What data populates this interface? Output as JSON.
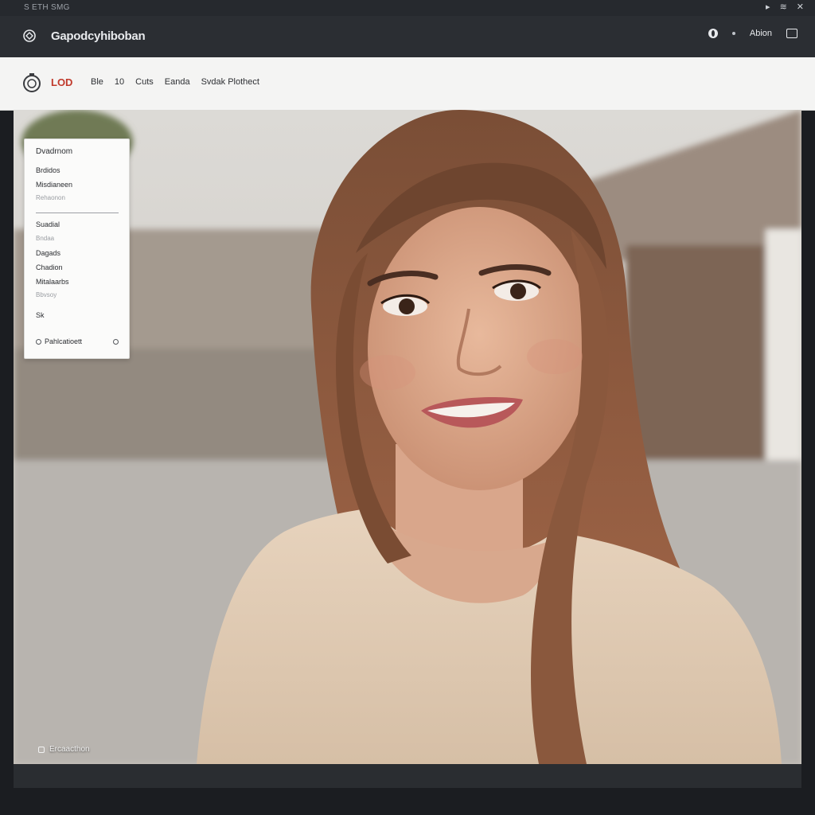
{
  "os_bar": {
    "title": "S ETH SMG",
    "icons": [
      "system-icon",
      "wifi-icon",
      "close-icon"
    ]
  },
  "app_bar": {
    "title": "Gapodcyhiboban",
    "right_label": "Abion",
    "icons": [
      "globe-icon",
      "dot-icon",
      "window-icon"
    ]
  },
  "nav_bar": {
    "brand": "LOD",
    "links": [
      "Ble",
      "10",
      "Cuts",
      "Eanda",
      "Svdak Plothect"
    ]
  },
  "dropdown": {
    "items": [
      {
        "label": "Dvadrnom",
        "muted": false
      },
      {
        "label": "Brdidos",
        "muted": false
      },
      {
        "label": "Misdianeen",
        "muted": false
      },
      {
        "label": "Rehaonon",
        "muted": true
      },
      {
        "label": "Suadial",
        "muted": false
      },
      {
        "label": "Bndaa",
        "muted": true
      },
      {
        "label": "Dagads",
        "muted": false
      },
      {
        "label": "Chadion",
        "muted": false
      },
      {
        "label": "Mitalaarbs",
        "muted": false
      },
      {
        "label": "Bbvsoy",
        "muted": true
      },
      {
        "label": "Sk",
        "muted": false
      }
    ],
    "footer_label": "Pahlcatioett"
  },
  "photo": {
    "caption": "Ercaacthon",
    "subject": "portrait-photo"
  },
  "colors": {
    "accent": "#c0392b",
    "chrome": "#2b2e33",
    "nav_bg": "#f4f4f3"
  }
}
